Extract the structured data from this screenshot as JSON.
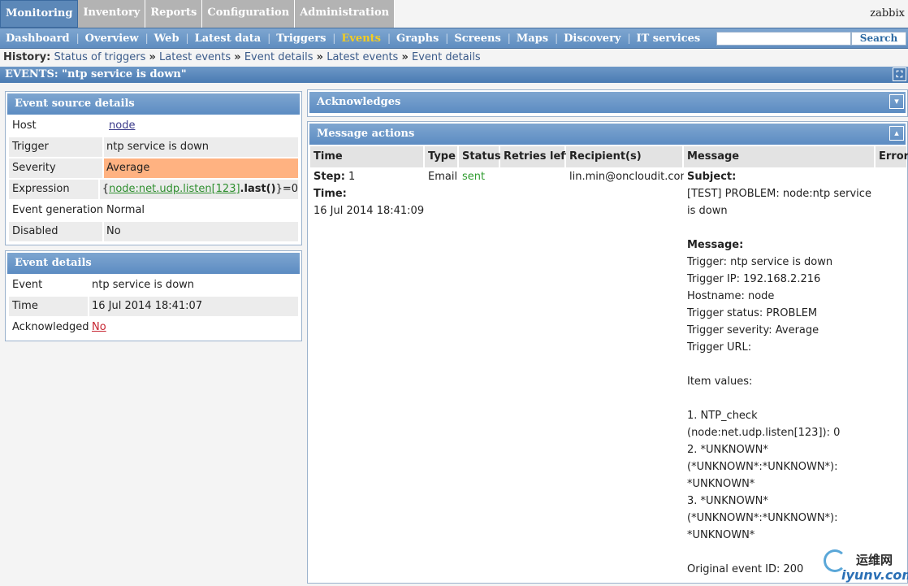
{
  "top_menu": [
    {
      "label": "Monitoring",
      "active": true
    },
    {
      "label": "Inventory"
    },
    {
      "label": "Reports"
    },
    {
      "label": "Configuration"
    },
    {
      "label": "Administration"
    }
  ],
  "user": "zabbix",
  "sub_menu": [
    "Dashboard",
    "Overview",
    "Web",
    "Latest data",
    "Triggers",
    "Events",
    "Graphs",
    "Screens",
    "Maps",
    "Discovery",
    "IT services"
  ],
  "sub_menu_active": "Events",
  "search": {
    "button": "Search",
    "value": ""
  },
  "history": {
    "label": "History:",
    "items": [
      "Status of triggers",
      "Latest events",
      "Event details",
      "Latest events",
      "Event details"
    ],
    "separator": "»"
  },
  "title": "EVENTS: \"ntp service is down\"",
  "event_source": {
    "title": "Event source details",
    "host_label": "Host",
    "host": "node",
    "trigger_label": "Trigger",
    "trigger": "ntp service is down",
    "severity_label": "Severity",
    "severity": "Average",
    "expression_label": "Expression",
    "expression_open": "{",
    "expression_item": "node:net.udp.listen[123]",
    "expression_dot": ".",
    "expression_func": "last()",
    "expression_close": "}=0",
    "event_generation_label": "Event generation",
    "event_generation": "Normal",
    "disabled_label": "Disabled",
    "disabled": "No"
  },
  "event_details": {
    "title": "Event details",
    "event_label": "Event",
    "event": "ntp service is down",
    "time_label": "Time",
    "time": "16 Jul 2014 18:41:07",
    "ack_label": "Acknowledged",
    "ack": "No"
  },
  "acknowledges": {
    "title": "Acknowledges"
  },
  "message_actions": {
    "title": "Message actions",
    "columns": [
      "Time",
      "Type",
      "Status",
      "Retries left",
      "Recipient(s)",
      "Message",
      "Error"
    ],
    "row": {
      "step_label": "Step:",
      "step": "1",
      "time_label": "Time:",
      "time": "16 Jul 2014 18:41:09",
      "type": "Email",
      "status": "sent",
      "retries": "",
      "recipient": "lin.min@oncloudit.com",
      "message_lines": [
        {
          "text": "Subject:",
          "bold": true
        },
        {
          "text": "[TEST] PROBLEM: node:ntp service"
        },
        {
          "text": "is down"
        },
        {
          "text": ""
        },
        {
          "text": "Message:",
          "bold": true
        },
        {
          "text": "Trigger: ntp service is down"
        },
        {
          "text": "Trigger IP: 192.168.2.216"
        },
        {
          "text": "Hostname: node"
        },
        {
          "text": "Trigger status: PROBLEM"
        },
        {
          "text": "Trigger severity: Average"
        },
        {
          "text": "Trigger URL:"
        },
        {
          "text": ""
        },
        {
          "text": "Item values:"
        },
        {
          "text": ""
        },
        {
          "text": "1. NTP_check"
        },
        {
          "text": "(node:net.udp.listen[123]): 0"
        },
        {
          "text": "2. *UNKNOWN*"
        },
        {
          "text": "(*UNKNOWN*:*UNKNOWN*):"
        },
        {
          "text": "*UNKNOWN*"
        },
        {
          "text": "3. *UNKNOWN*"
        },
        {
          "text": "(*UNKNOWN*:*UNKNOWN*):"
        },
        {
          "text": "*UNKNOWN*"
        },
        {
          "text": ""
        },
        {
          "text": "Original event ID: 200"
        }
      ],
      "error": ""
    }
  },
  "watermark": {
    "cn": "运维网",
    "en": "iyunv.com"
  },
  "colors": {
    "severity_average": "#ffb281",
    "header_blue": "#5c8cc2",
    "active_menu": "#f2cc22"
  }
}
